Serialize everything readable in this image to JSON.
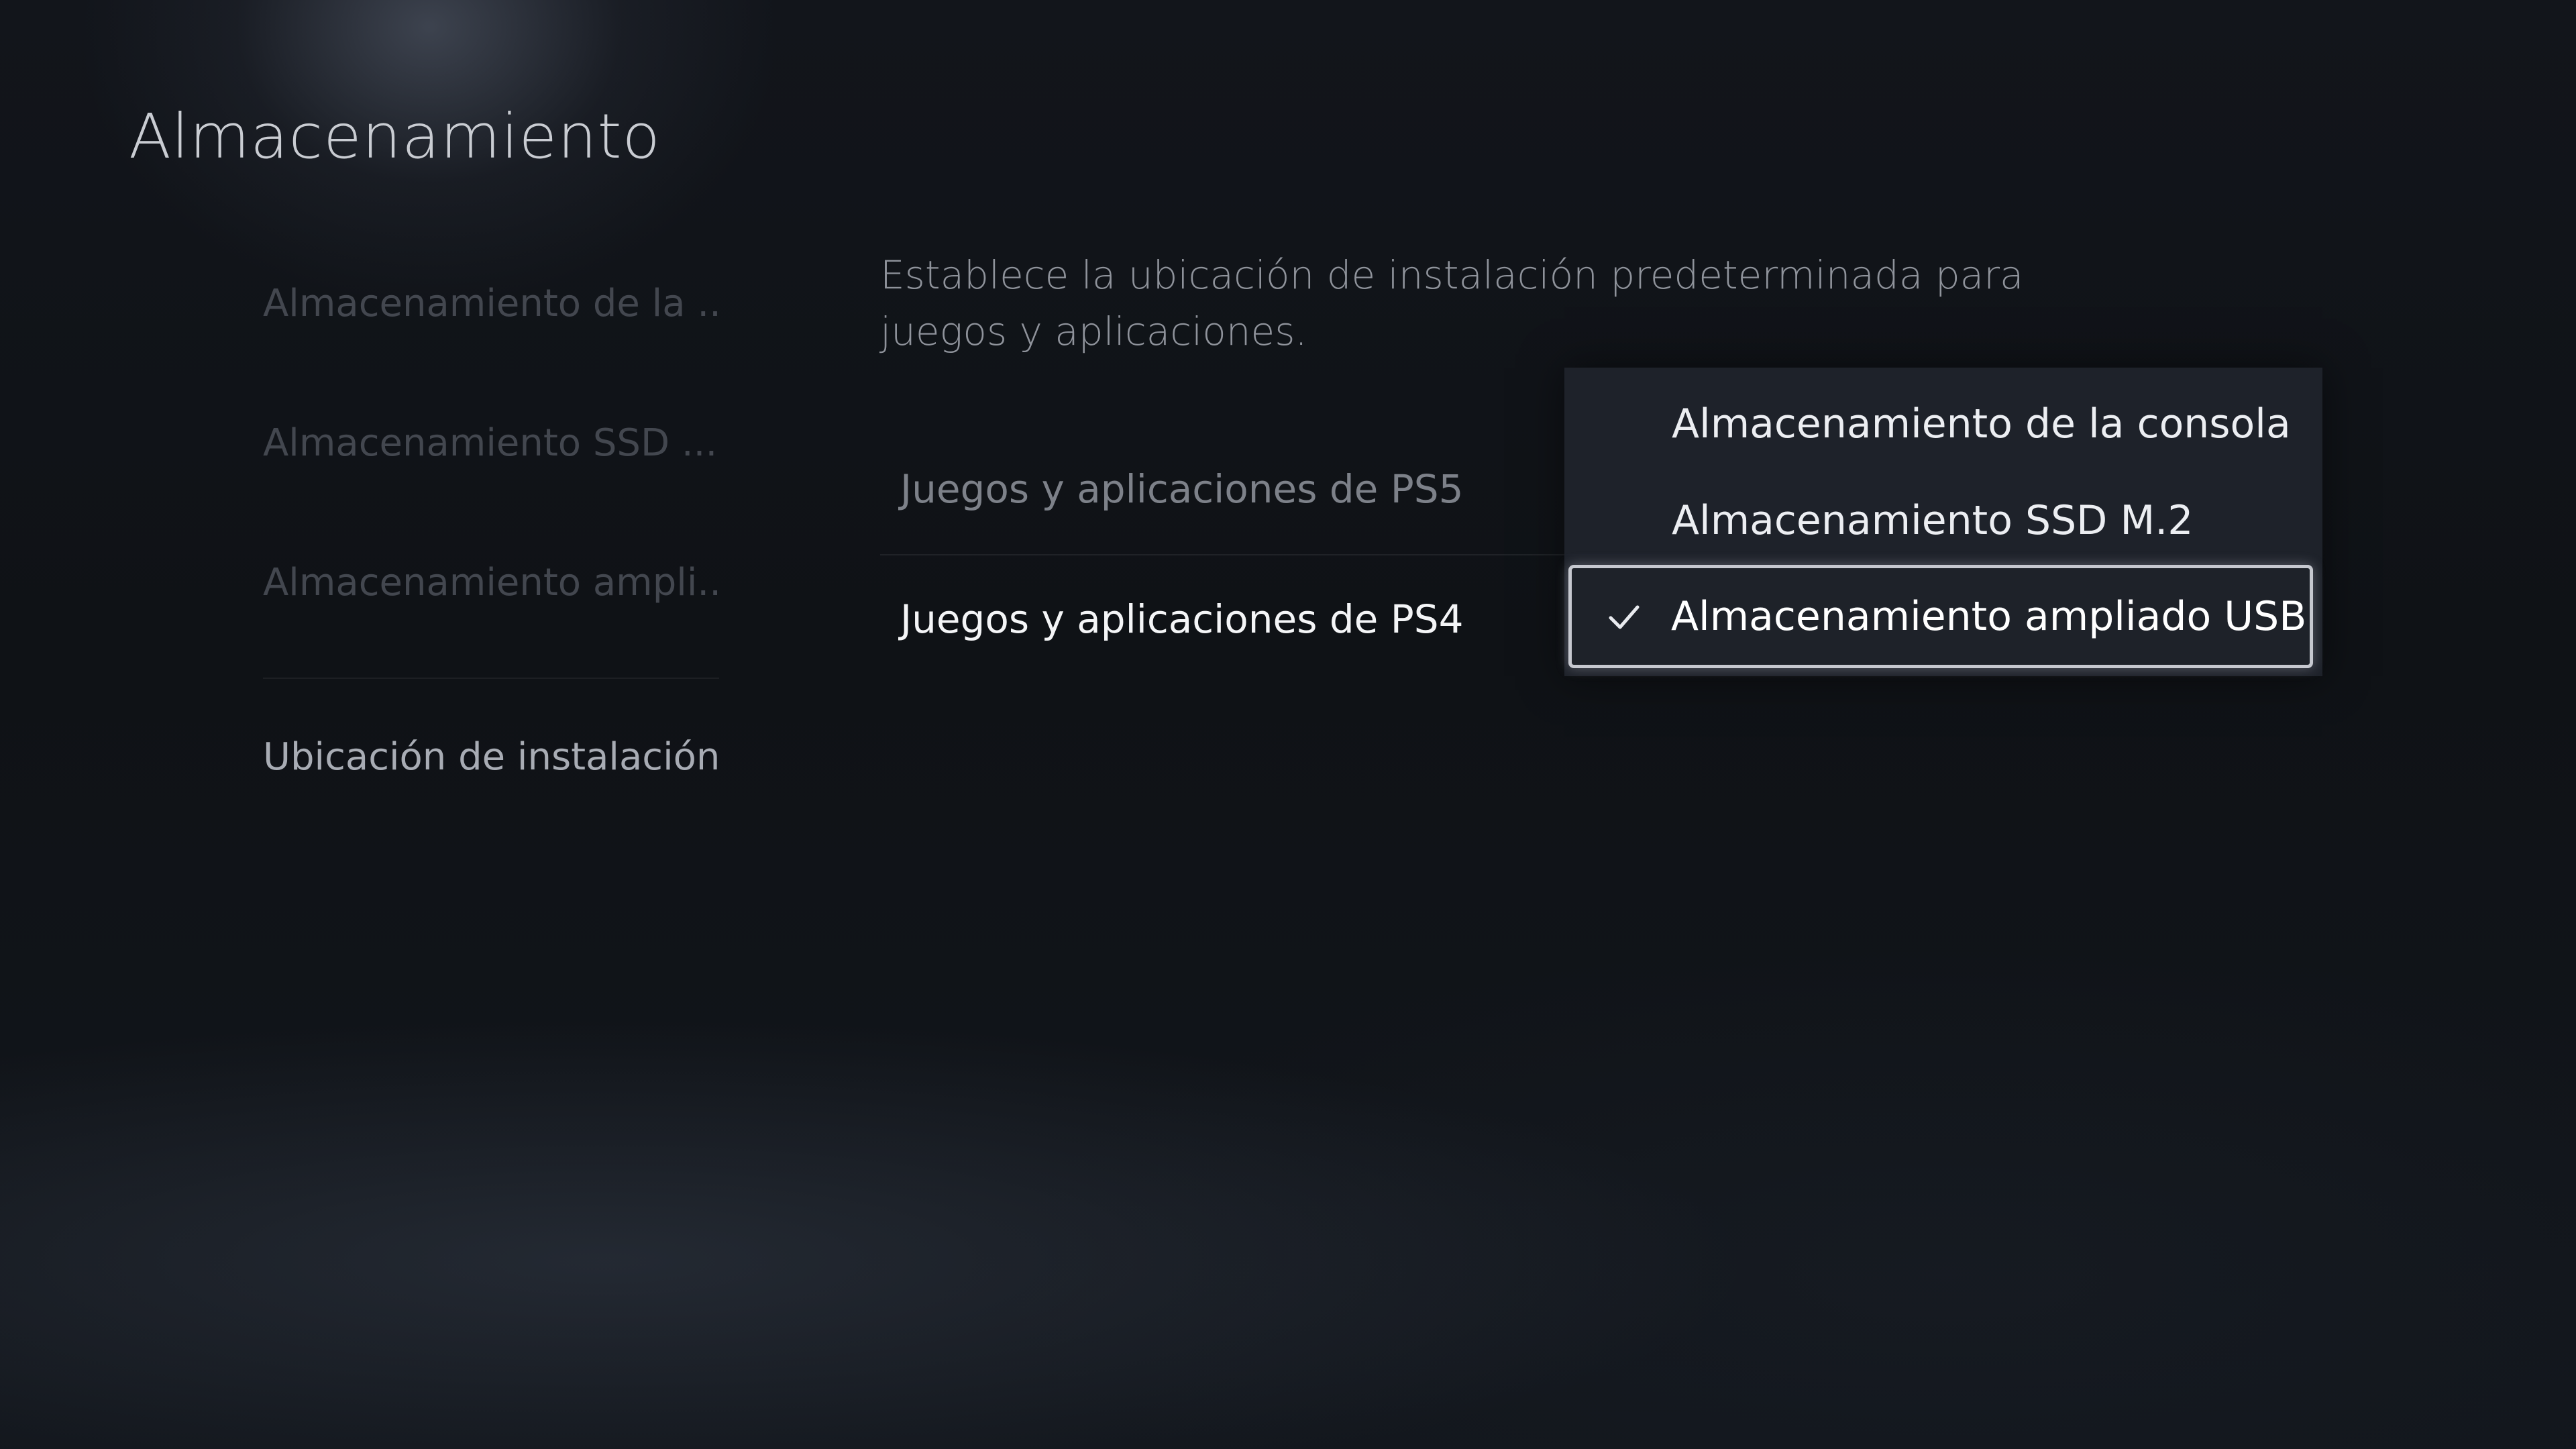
{
  "header": {
    "title": "Almacenamiento"
  },
  "sidebar": {
    "items": [
      {
        "label": "Almacenamiento de la ..."
      },
      {
        "label": "Almacenamiento SSD ..."
      },
      {
        "label": "Almacenamiento ampli..."
      },
      {
        "label": "Ubicación de instalación"
      }
    ],
    "selected_index": 3
  },
  "main": {
    "description": "Establece la ubicación de instalación predeterminada para juegos y aplicaciones.",
    "settings": [
      {
        "label": "Juegos y aplicaciones de PS5"
      },
      {
        "label": "Juegos y aplicaciones de PS4"
      }
    ]
  },
  "dropdown": {
    "options": [
      {
        "label": "Almacenamiento de la consola"
      },
      {
        "label": "Almacenamiento SSD M.2"
      },
      {
        "label": "Almacenamiento ampliado USB"
      }
    ],
    "selected_index": 2,
    "selected_icon": "check-icon"
  }
}
